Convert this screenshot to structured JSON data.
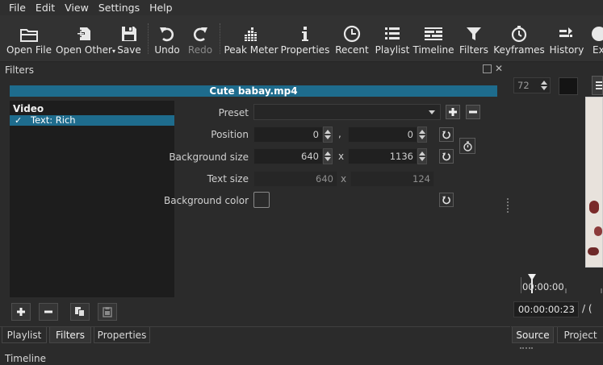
{
  "menu": [
    "File",
    "Edit",
    "View",
    "Settings",
    "Help"
  ],
  "toolbar": {
    "open_file": "Open File",
    "open_other": "Open Other",
    "save": "Save",
    "undo": "Undo",
    "redo": "Redo",
    "peak_meter": "Peak Meter",
    "properties": "Properties",
    "recent": "Recent",
    "playlist": "Playlist",
    "timeline": "Timeline",
    "filters": "Filters",
    "keyframes": "Keyframes",
    "history": "History",
    "export": "Ex"
  },
  "filters_panel": {
    "title": "Filters",
    "clip_name": "Cute babay.mp4",
    "list": {
      "group": "Video",
      "item_check": "✓",
      "item_label": "Text: Rich"
    },
    "preset": {
      "label": "Preset",
      "value": ""
    },
    "position": {
      "label": "Position",
      "x": "0",
      "sep": ",",
      "y": "0"
    },
    "background_size": {
      "label": "Background size",
      "w": "640",
      "sep": "x",
      "h": "1136"
    },
    "text_size": {
      "label": "Text size",
      "w": "640",
      "sep": "x",
      "h": "124"
    },
    "background_color": {
      "label": "Background color",
      "color": "#2b2b2b"
    }
  },
  "tabs": [
    "Playlist",
    "Filters",
    "Properties"
  ],
  "bottom_dock": {
    "timeline_label": "Timeline"
  },
  "player": {
    "zoom_value": "72",
    "ruler_time": "00:00:00",
    "current_time": "00:00:00:23",
    "time_sep": "/ (",
    "source_tab": "Source",
    "project_tab": "Project"
  },
  "colors": {
    "accent": "#1e6c8d",
    "background": "#2b2b2b",
    "toolbar_bg": "#323232"
  }
}
